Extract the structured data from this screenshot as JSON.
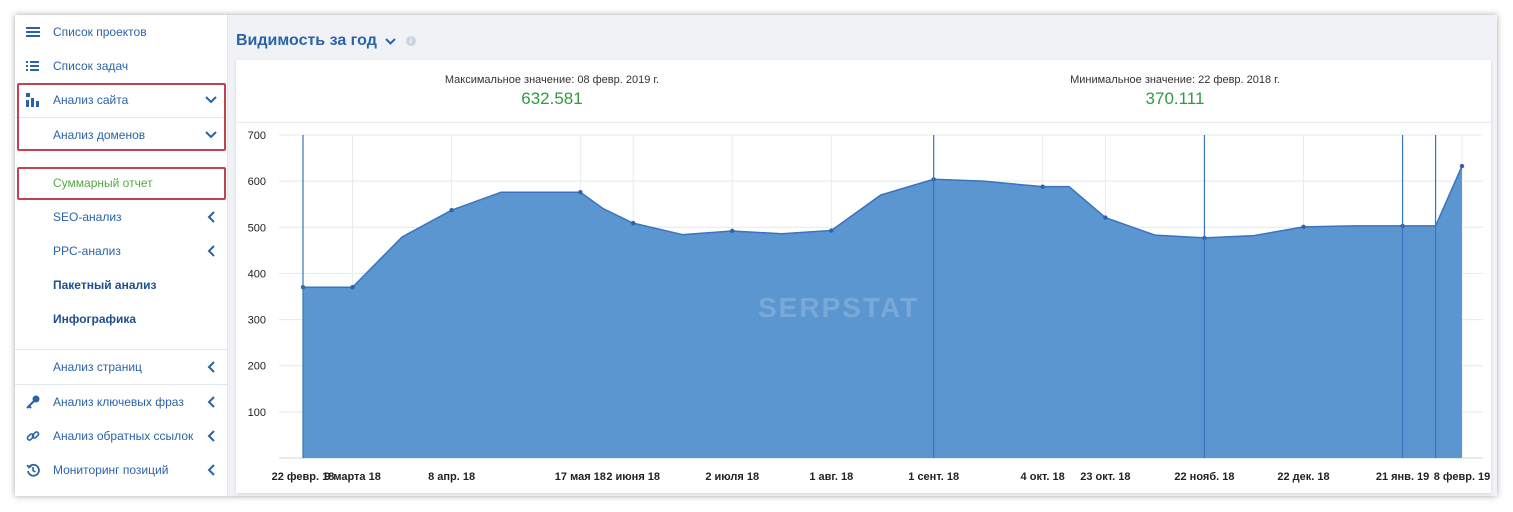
{
  "sidebar": {
    "items": [
      {
        "label": "Список проектов",
        "icon": "hamburger-icon"
      },
      {
        "label": "Список задач",
        "icon": "list-icon"
      },
      {
        "label": "Анализ сайта",
        "icon": "site-analysis-icon"
      },
      {
        "label": "Анализ доменов"
      },
      {
        "label": "Суммарный отчет"
      },
      {
        "label": "SEO-анализ"
      },
      {
        "label": "PPC-анализ"
      },
      {
        "label": "Пакетный анализ"
      },
      {
        "label": "Инфографика"
      },
      {
        "label": "Анализ страниц"
      },
      {
        "label": "Анализ ключевых фраз",
        "icon": "key-icon"
      },
      {
        "label": "Анализ обратных ссылок",
        "icon": "link-icon"
      },
      {
        "label": "Мониторинг позиций",
        "icon": "history-icon"
      }
    ]
  },
  "main": {
    "title": "Видимость за год",
    "max_caption": "Максимальное значение: 08 февр. 2019 г.",
    "max_value": "632.581",
    "min_caption": "Минимальное значение: 22 февр. 2018 г.",
    "min_value": "370.111",
    "watermark": "SERPSTAT"
  },
  "colors": {
    "accent": "#2a63a8",
    "active": "#56a845",
    "value_green": "#2f9b3e",
    "area_fill": "#5b96d1",
    "area_line": "#3a74bf",
    "highlight_border": "#c4424f"
  },
  "chart_data": {
    "type": "area",
    "ylim": [
      0,
      700
    ],
    "yticks": [
      100,
      200,
      300,
      400,
      500,
      600,
      700
    ],
    "x_tick_labels": [
      "22 февр. 18",
      "9 марта 18",
      "8 апр. 18",
      "17 мая 18",
      "2 июня 18",
      "2 июля 18",
      "1 авг. 18",
      "1 сент. 18",
      "4 окт. 18",
      "23 окт. 18",
      "22 нояб. 18",
      "22 дек. 18",
      "21 янв. 19",
      "8 февр. 19"
    ],
    "x": [
      "2018-02-22",
      "2018-03-09",
      "2018-03-24",
      "2018-04-08",
      "2018-04-23",
      "2018-05-17",
      "2018-05-24",
      "2018-06-02",
      "2018-06-17",
      "2018-07-02",
      "2018-07-17",
      "2018-08-01",
      "2018-08-16",
      "2018-09-01",
      "2018-09-16",
      "2018-10-04",
      "2018-10-12",
      "2018-10-23",
      "2018-11-07",
      "2018-11-22",
      "2018-12-07",
      "2018-12-22",
      "2019-01-06",
      "2019-01-21",
      "2019-01-31",
      "2019-02-08"
    ],
    "values": [
      370.111,
      370.1,
      479,
      537,
      576,
      576,
      540,
      509,
      484,
      492,
      486,
      493,
      570,
      604,
      600,
      588,
      588,
      521,
      483,
      477,
      482,
      501,
      503,
      503,
      503,
      632.581
    ],
    "markers": [
      "2018-02-22",
      "2018-03-09",
      "2018-04-08",
      "2018-05-17",
      "2018-06-02",
      "2018-07-02",
      "2018-08-01",
      "2018-09-01",
      "2018-10-04",
      "2018-10-23",
      "2018-11-22",
      "2018-12-22",
      "2019-01-21",
      "2019-02-08"
    ],
    "event_lines": [
      "2018-02-22",
      "2018-09-01",
      "2018-11-22",
      "2019-01-21",
      "2019-01-31"
    ],
    "grid": true
  }
}
